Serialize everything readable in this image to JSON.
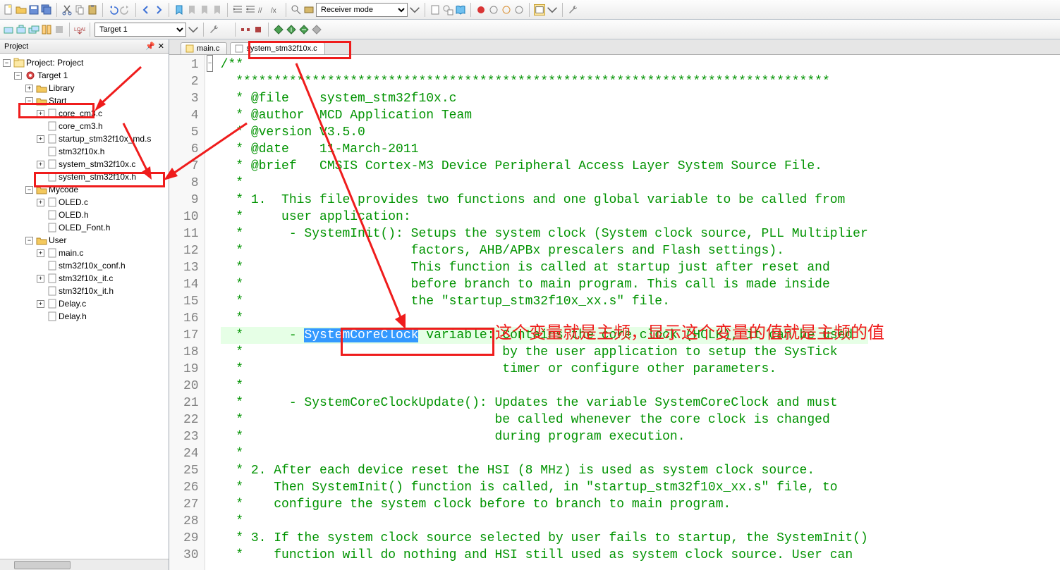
{
  "toolbar": {
    "receiver_mode": "Receiver mode",
    "target": "Target 1"
  },
  "project": {
    "title": "Project",
    "root": "Project: Project",
    "target": "Target 1",
    "folders": {
      "library": "Library",
      "start": "Start",
      "mycode": "Mycode",
      "user": "User"
    },
    "start_files": [
      "core_cm3.c",
      "core_cm3.h",
      "startup_stm32f10x_md.s",
      "stm32f10x.h",
      "system_stm32f10x.c",
      "system_stm32f10x.h"
    ],
    "mycode_files": [
      "OLED.c",
      "OLED.h",
      "OLED_Font.h"
    ],
    "user_files": [
      "main.c",
      "stm32f10x_conf.h",
      "stm32f10x_it.c",
      "stm32f10x_it.h",
      "Delay.c",
      "Delay.h"
    ]
  },
  "tabs": {
    "t0": "main.c",
    "t1": "system_stm32f10x.c"
  },
  "code": {
    "lines": [
      "/**",
      "  ******************************************************************************",
      "  * @file    system_stm32f10x.c",
      "  * @author  MCD Application Team",
      "  * @version V3.5.0",
      "  * @date    11-March-2011",
      "  * @brief   CMSIS Cortex-M3 Device Peripheral Access Layer System Source File.",
      "  * ",
      "  * 1.  This file provides two functions and one global variable to be called from ",
      "  *     user application:",
      "  *      - SystemInit(): Setups the system clock (System clock source, PLL Multiplier",
      "  *                      factors, AHB/APBx prescalers and Flash settings). ",
      "  *                      This function is called at startup just after reset and ",
      "  *                      before branch to main program. This call is made inside",
      "  *                      the \"startup_stm32f10x_xx.s\" file.",
      "  *",
      "  *      - SystemCoreClock variable: Contains the core clock (HCLK), it can be used",
      "  *                                  by the user application to setup the SysTick ",
      "  *                                  timer or configure other parameters.",
      "  *                                     ",
      "  *      - SystemCoreClockUpdate(): Updates the variable SystemCoreClock and must",
      "  *                                 be called whenever the core clock is changed",
      "  *                                 during program execution.",
      "  *",
      "  * 2. After each device reset the HSI (8 MHz) is used as system clock source.",
      "  *    Then SystemInit() function is called, in \"startup_stm32f10x_xx.s\" file, to",
      "  *    configure the system clock before to branch to main program.",
      "  *",
      "  * 3. If the system clock source selected by user fails to startup, the SystemInit()",
      "  *    function will do nothing and HSI still used as system clock source. User can "
    ],
    "selected_token": "SystemCoreClock",
    "highlight_line_index": 16
  },
  "annotation": {
    "text": "这个变量就是主频，显示这个变量的值就是主频的值"
  }
}
